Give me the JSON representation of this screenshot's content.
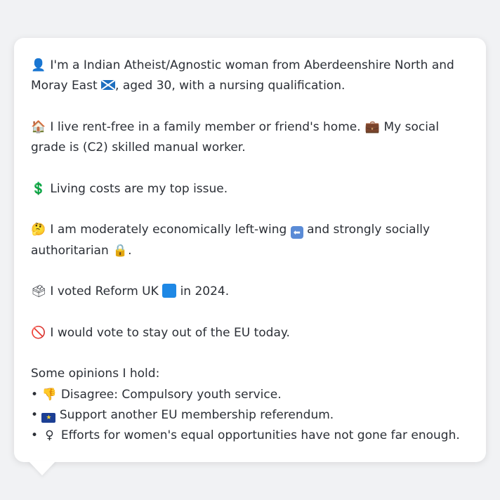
{
  "persona": {
    "identity": {
      "icon": "👤",
      "text_before_flag": "I'm a Indian Atheist/Agnostic woman from Aberdeenshire North and Moray East",
      "flag_icon": "scotland-flag-icon",
      "text_after_flag": ", aged 30, with a nursing qualification."
    },
    "housing": {
      "house_icon": "🏠",
      "text": "I live rent-free in a family member or friend's home.",
      "briefcase_icon": "💼",
      "grade_text": "My social grade is (C2) skilled manual worker."
    },
    "issue": {
      "icon": "💲",
      "text": "Living costs are my top issue."
    },
    "politics": {
      "icon": "🤔",
      "text_before_left": "I am moderately economically left-wing",
      "left_arrow_icon": "⬅",
      "text_middle": "and strongly socially authoritarian",
      "lock_icon": "🔒",
      "text_end": "."
    },
    "vote": {
      "icon": "🗳",
      "text_before": "I voted Reform UK",
      "party_color": "#1e88e5",
      "text_after": "in 2024."
    },
    "eu": {
      "icon": "🚫",
      "text": "I would vote to stay out of the EU today."
    },
    "opinions": {
      "heading": "Some opinions I hold:",
      "bullet": "•",
      "items": [
        {
          "icon": "👎",
          "text": "Disagree: Compulsory youth service."
        },
        {
          "icon": "eu-flag-icon",
          "text": "Support another EU membership referendum."
        },
        {
          "icon": "♀",
          "text": "Efforts for women's equal opportunities have not gone far enough."
        }
      ]
    }
  },
  "colors": {
    "background": "#f1f2f4",
    "card": "#ffffff",
    "text": "#2b2f36"
  }
}
